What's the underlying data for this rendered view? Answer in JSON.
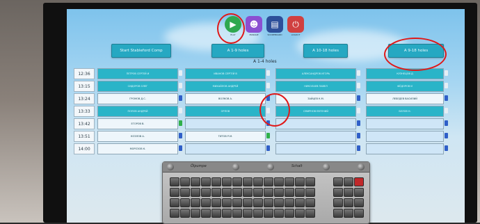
{
  "toolbar": {
    "buttons": [
      {
        "icon": "play-icon",
        "label": "PLAY",
        "color": "#2fa84f"
      },
      {
        "icon": "users-icon",
        "label": "MANAGE",
        "color": "#8b4fd1"
      },
      {
        "icon": "document-icon",
        "label": "SCOREBOARD",
        "color": "#2d4f9a"
      },
      {
        "icon": "power-icon",
        "label": "LOGOUT",
        "color": "#d04040"
      }
    ]
  },
  "tee_headers": {
    "col1": "Start Stableford Comp",
    "col2": "A 1-9 holes",
    "col3": "A 10-18 holes",
    "col4": "A 9-18 holes"
  },
  "subtitle": "A 1-4 holes",
  "rows": [
    {
      "time": "12:36",
      "cells": [
        "ПЕТРОВ СЕРГЕЙ И",
        "ИВАНОВ СЕРГЕЙ В",
        "АЛЕКСАНДРОВ ИГОРЬ",
        "КУЗНЕЦОВ Д"
      ],
      "types": [
        "t",
        "t",
        "t",
        "t"
      ]
    },
    {
      "time": "13:15",
      "cells": [
        "СИДОРОВ ОЛЕГ",
        "МИХАЙЛОВ АНДРЕЙ",
        "НИКОЛАЕВ ПАВЕЛ",
        "ФЁДОРОВ И"
      ],
      "types": [
        "t",
        "t",
        "t",
        "t"
      ]
    },
    {
      "time": "13:24",
      "cells": [
        "ГРОМОВ Д.С.",
        "ВОЛКОВ А.",
        "ЗАЙЦЕВ К.М.",
        "ЛЕБЕДЕВ ВАСИЛИЙ"
      ],
      "types": [
        "",
        "",
        "",
        ""
      ]
    },
    {
      "time": "13:33",
      "cells": [
        "ПОПОВ АНДРЕЙ",
        "ОРЛОВ",
        "СМИРНОВ ЕВГЕНИЙ",
        "БЕЛОВ Н."
      ],
      "types": [
        "t",
        "t",
        "t",
        "t"
      ]
    },
    {
      "time": "13:42",
      "cells": [
        "ЕГОРОВ В.",
        "",
        "",
        ""
      ],
      "types": [
        "",
        "e",
        "e",
        "e"
      ]
    },
    {
      "time": "13:51",
      "cells": [
        "КОЗЛОВ А.",
        "ТИТОВ Р.М.",
        "",
        ""
      ],
      "types": [
        "",
        "",
        "e",
        "e"
      ]
    },
    {
      "time": "14:00",
      "cells": [
        "МОРОЗОВ К.",
        "",
        "",
        ""
      ],
      "types": [
        "",
        "e",
        "e",
        "e"
      ]
    }
  ],
  "keyboard": {
    "left_label": "Ölpumpe",
    "right_label": "Schalt"
  }
}
